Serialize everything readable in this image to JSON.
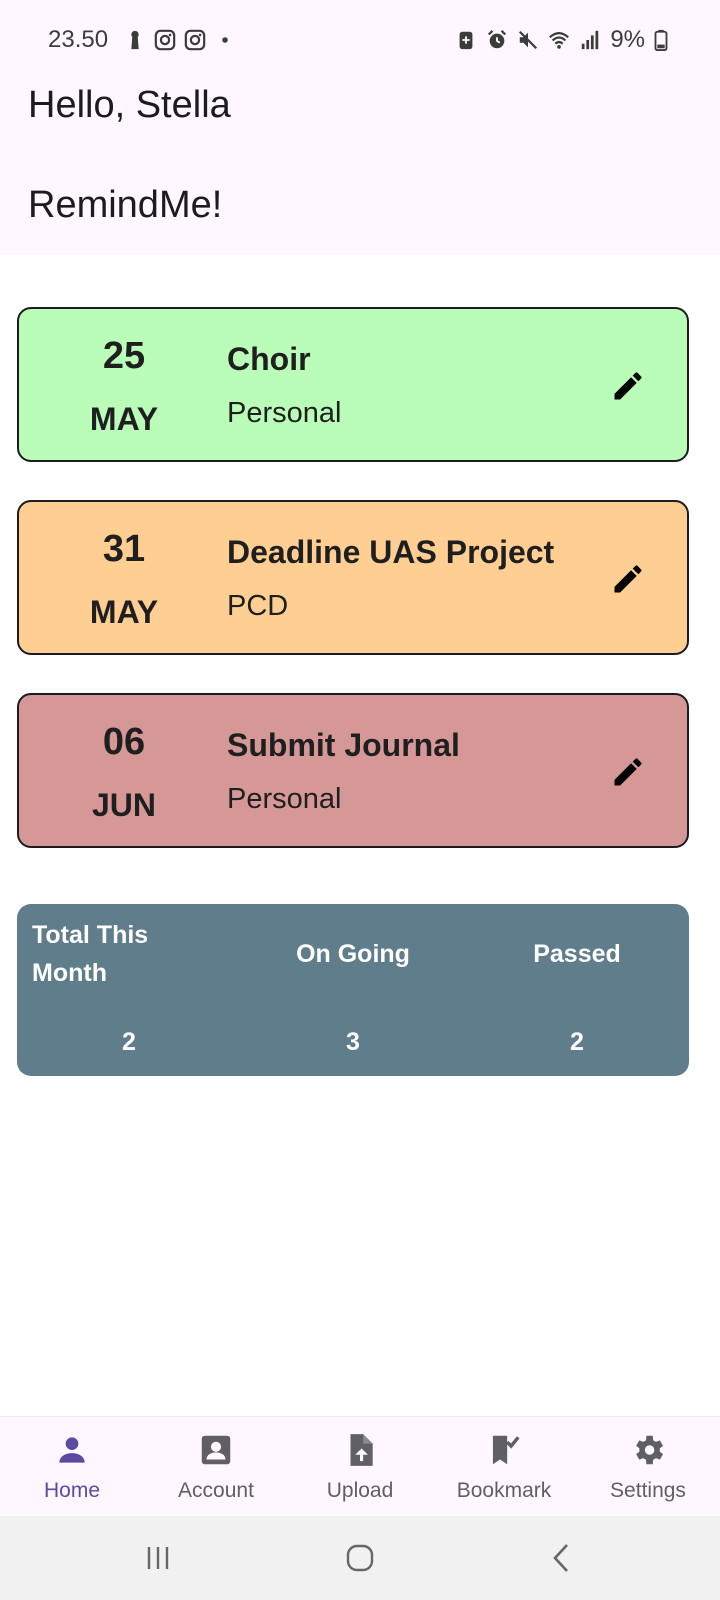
{
  "status_bar": {
    "time": "23.50",
    "battery_percent": "9%",
    "left_icons": [
      "keyhole-icon",
      "instagram-icon",
      "instagram-icon",
      "dot-icon"
    ],
    "right_icons": [
      "battery-saver-icon",
      "alarm-icon",
      "mute-icon",
      "wifi-icon",
      "signal-icon",
      "battery-icon"
    ]
  },
  "header": {
    "greeting": "Hello, Stella",
    "app_title": "RemindMe!"
  },
  "reminders": [
    {
      "day": "25",
      "month": "MAY",
      "title": "Choir",
      "category": "Personal",
      "color": "#b9fdb8"
    },
    {
      "day": "31",
      "month": "MAY",
      "title": "Deadline UAS Project",
      "category": "PCD",
      "color": "#fece93"
    },
    {
      "day": "06",
      "month": "JUN",
      "title": "Submit Journal",
      "category": "Personal",
      "color": "#d69896"
    }
  ],
  "summary": {
    "total_label": "Total This Month",
    "total_value": "2",
    "ongoing_label": "On Going",
    "ongoing_value": "3",
    "passed_label": "Passed",
    "passed_value": "2",
    "color": "#607d8b"
  },
  "bottom_nav": {
    "active_color": "#5b4aa0",
    "items": [
      {
        "label": "Home",
        "icon": "person-icon"
      },
      {
        "label": "Account",
        "icon": "account-box-icon"
      },
      {
        "label": "Upload",
        "icon": "upload-file-icon"
      },
      {
        "label": "Bookmark",
        "icon": "bookmark-check-icon"
      },
      {
        "label": "Settings",
        "icon": "gear-icon"
      }
    ]
  }
}
